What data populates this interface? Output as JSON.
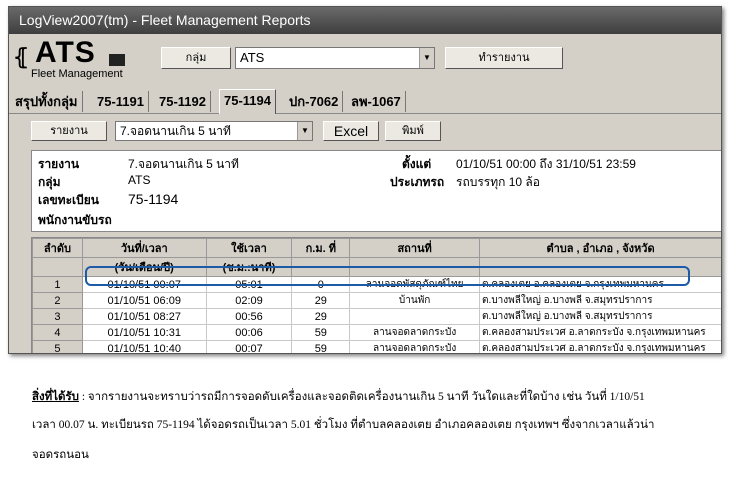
{
  "window": {
    "title": "LogView2007(tm) - Fleet Management Reports"
  },
  "logo": {
    "brand": "ATS",
    "subtitle": "Fleet Management"
  },
  "toolbar": {
    "group_button": "กลุ่ม",
    "group_value": "ATS",
    "report_button": "ทำรายงาน"
  },
  "tabs": [
    "สรุปทั้งกลุ่ม",
    "75-1191",
    "75-1192",
    "75-1194",
    "ปก-7062",
    "ลพ-1067"
  ],
  "active_tab": "75-1194",
  "report_bar": {
    "report_button": "รายงาน",
    "report_value": "7.จอดนานเกิน 5 นาที",
    "excel_button": "Excel",
    "print_button": "พิมพ์"
  },
  "info": {
    "report_label": "รายงาน",
    "report_value": "7.จอดนานเกิน 5 นาที",
    "group_label": "กลุ่ม",
    "group_value": "ATS",
    "plate_label": "เลขทะเบียน",
    "plate_value": "75-1194",
    "driver_label": "พนักงานขับรถ",
    "since_label": "ตั้งแต่",
    "since_value": "01/10/51  00:00 ถึง 31/10/51  23:59",
    "type_label": "ประเภทรถ",
    "type_value": "รถบรรทุก 10 ล้อ"
  },
  "table": {
    "headers": [
      "ลำดับ",
      "วันที่/เวลา",
      "ใช้เวลา",
      "ก.ม. ที่",
      "สถานที่",
      "ตำบล , อำเภอ , จังหวัด"
    ],
    "subheaders": [
      "",
      "(วัน/เดือน/ปี)",
      "(ช.ม.:นาที)",
      "",
      "",
      ""
    ],
    "rows": [
      [
        "1",
        "01/10/51  00:07",
        "05:01",
        "0",
        "ลานจอดพัสดุภัณฑ์ไทย",
        "ต.คลองเตย อ.คลองเตย จ.กรุงเทพมหานคร"
      ],
      [
        "2",
        "01/10/51  06:09",
        "02:09",
        "29",
        "บ้านพัก",
        "ต.บางพลีใหญ่ อ.บางพลี จ.สมุทรปราการ"
      ],
      [
        "3",
        "01/10/51  08:27",
        "00:56",
        "29",
        "",
        "ต.บางพลีใหญ่ อ.บางพลี จ.สมุทรปราการ"
      ],
      [
        "4",
        "01/10/51  10:31",
        "00:06",
        "59",
        "ลานจอดลาดกระบัง",
        "ต.คลองสามประเวศ อ.ลาดกระบัง จ.กรุงเทพมหานคร"
      ],
      [
        "5",
        "01/10/51  10:40",
        "00:07",
        "59",
        "ลานจอดลาดกระบัง",
        "ต.คลองสามประเวศ อ.ลาดกระบัง จ.กรุงเทพมหานคร"
      ]
    ]
  },
  "note": {
    "heading": "สิ่งที่ได้รับ",
    "line1": " : จากรายงานจะทราบว่ารถมีการจอดดับเครื่องและจอดติดเครื่องนานเกิน 5 นาที วันใดและที่ใดบ้าง เช่น วันที่ 1/10/51",
    "line2": "เวลา 00.07 น. ทะเบียนรถ 75-1194 ได้จอดรถเป็นเวลา 5.01 ชั่วโมง ที่ตำบลคลองเตย อำเภอคลองเตย กรุงเทพฯ ซึ่งจากเวลาแล้วน่า",
    "line3": "จอดรถนอน"
  }
}
